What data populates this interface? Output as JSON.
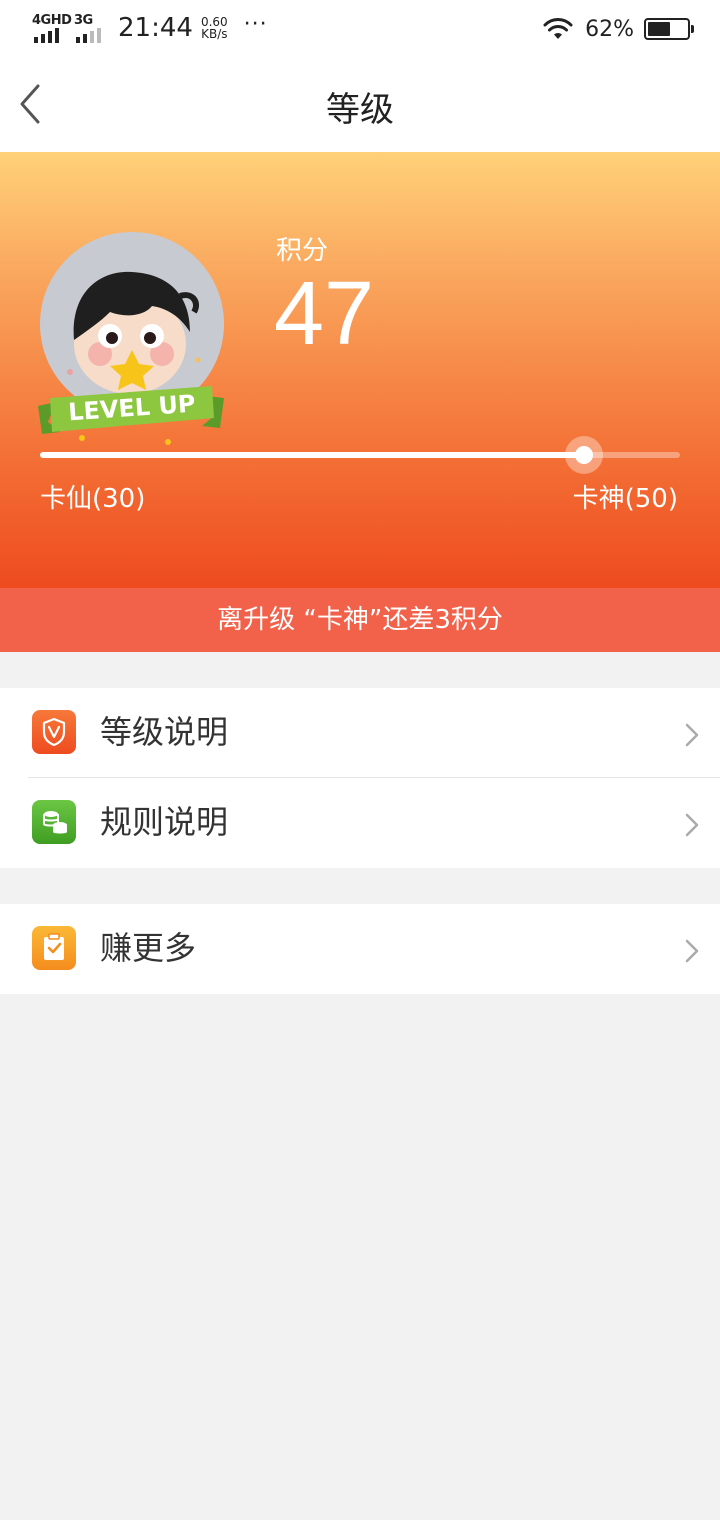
{
  "status_bar": {
    "network_1": "4GHD",
    "network_2": "3G",
    "time": "21:44",
    "speed_value": "0.60",
    "speed_unit": "KB/s",
    "more": "···",
    "battery_percent": "62%",
    "battery_level": 0.62
  },
  "nav": {
    "title": "等级"
  },
  "hero": {
    "points_label": "积分",
    "points_value": "47",
    "badge_text": "LEVEL UP",
    "level_left": "卡仙(30)",
    "level_right": "卡神(50)",
    "progress": 0.85,
    "colors": {
      "gradient_top": "#ffd179",
      "gradient_bottom": "#ee4b1f"
    }
  },
  "banner": {
    "text": "离升级 “卡神”还差3积分",
    "color": "#f2614a"
  },
  "menu": {
    "group1": [
      {
        "label": "等级说明",
        "icon": "shield-v-icon",
        "icon_color": "#f05a24"
      },
      {
        "label": "规则说明",
        "icon": "coins-icon",
        "icon_color": "#4caf28"
      }
    ],
    "group2": [
      {
        "label": "赚更多",
        "icon": "clipboard-check-icon",
        "icon_color": "#f7a21e"
      }
    ]
  }
}
